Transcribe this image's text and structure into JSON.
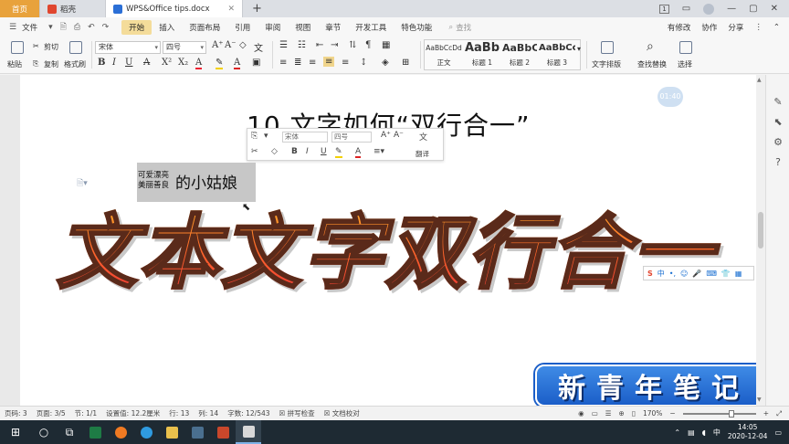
{
  "tabs": {
    "home": "首页",
    "daoke": "稻壳",
    "doc": "WPS&Office  tips.docx",
    "new_tab": "+"
  },
  "window": {
    "indicator": "1"
  },
  "menu": {
    "file": "文件",
    "items": [
      "开始",
      "插入",
      "页面布局",
      "引用",
      "审阅",
      "视图",
      "章节",
      "开发工具",
      "特色功能"
    ],
    "search": "查找",
    "right": [
      "有修改",
      "协作",
      "分享"
    ]
  },
  "ribbon": {
    "paste": "粘贴",
    "cut": "剪切",
    "copy": "复制",
    "format_painter": "格式刷",
    "font_name": "宋体",
    "font_size": "四号",
    "styles": [
      {
        "sample": "AaBbCcDd",
        "label": "正文"
      },
      {
        "sample": "AaBb",
        "label": "标题 1"
      },
      {
        "sample": "AaBbC",
        "label": "标题 2"
      },
      {
        "sample": "AaBbCc",
        "label": "标题 3"
      }
    ],
    "text_layout": "文字排版",
    "find_replace": "查找替换",
    "select": "选择"
  },
  "document": {
    "title": "10 文字如何“双行合一”",
    "timer": "01:40",
    "two_line_top": "可爱漂亮",
    "two_line_bottom": "美丽善良",
    "main_text": "的小姑娘",
    "banner": "文本文字双行合一",
    "badge": "新青年笔记"
  },
  "minibar": {
    "font": "宋体",
    "size": "四号",
    "translate": "翻译"
  },
  "ime": {
    "mode": "中"
  },
  "status": {
    "page_num": "页码: 3",
    "pages": "页面: 3/5",
    "section": "节: 1/1",
    "setting": "设置值: 12.2厘米",
    "row": "行: 13",
    "col": "列: 14",
    "words": "字数: 12/543",
    "spell": "拼写检查",
    "proof": "文档校对",
    "zoom": "170%",
    "zoom_level": 0.68
  },
  "taskbar": {
    "time": "14:05",
    "date": "2020-12-04"
  }
}
